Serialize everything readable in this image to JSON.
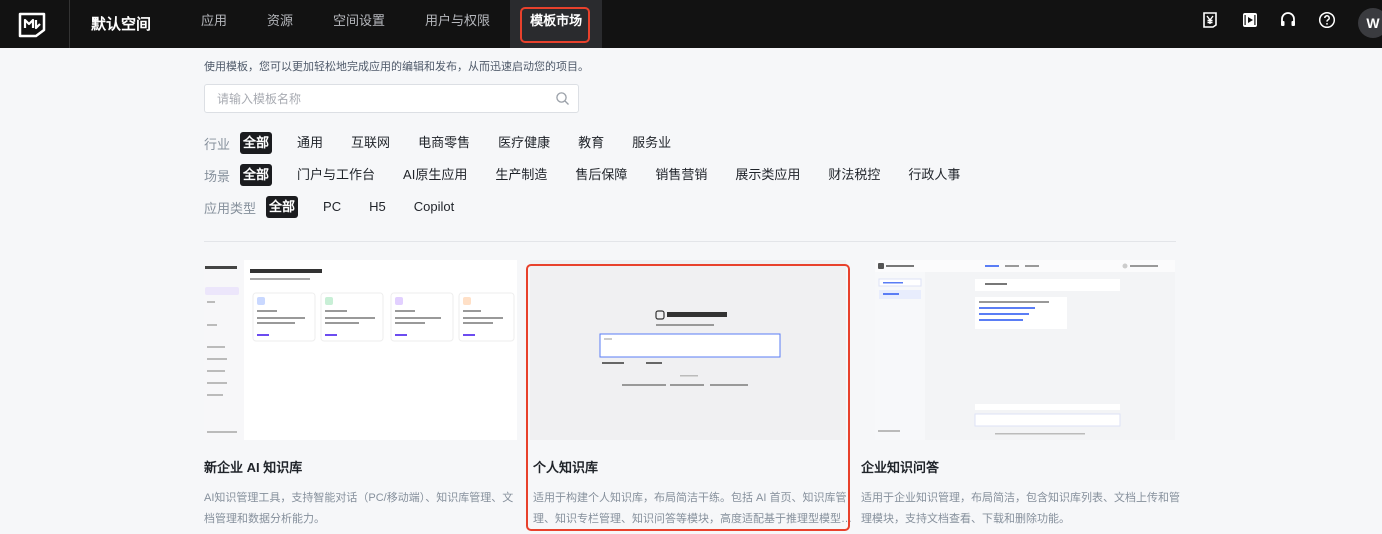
{
  "topbar": {
    "space_name": "默认空间",
    "nav": [
      {
        "label": "应用"
      },
      {
        "label": "资源"
      },
      {
        "label": "空间设置"
      },
      {
        "label": "用户与权限"
      },
      {
        "label": "模板市场",
        "active": true
      }
    ],
    "icons": [
      "yen-icon",
      "video-icon",
      "headset-icon",
      "help-icon"
    ],
    "avatar_letter": "W",
    "highlight_color": "#e8412c"
  },
  "intro_text": "使用模板，您可以更加轻松地完成应用的编辑和发布，从而迅速启动您的项目。",
  "search": {
    "placeholder": "请输入模板名称",
    "value": ""
  },
  "filters": {
    "industry": {
      "label": "行业",
      "options": [
        "全部",
        "通用",
        "互联网",
        "电商零售",
        "医疗健康",
        "教育",
        "服务业"
      ],
      "selected": "全部"
    },
    "scene": {
      "label": "场景",
      "options": [
        "全部",
        "门户与工作台",
        "AI原生应用",
        "生产制造",
        "售后保障",
        "销售营销",
        "展示类应用",
        "财法税控",
        "行政人事"
      ],
      "selected": "全部"
    },
    "app_type": {
      "label": "应用类型",
      "options": [
        "全部",
        "PC",
        "H5",
        "Copilot"
      ],
      "selected": "全部"
    }
  },
  "cards": [
    {
      "title": "新企业 AI 知识库",
      "desc_line1": "AI知识管理工具，支持智能对话（PC/移动端）、知识库管理、文",
      "desc_line2": "档管理和数据分析能力。"
    },
    {
      "title": "个人知识库",
      "desc_line1": "适用于构建个人知识库，布局简洁干练。包括 AI 首页、知识库管",
      "desc_line2": "理、知识专栏管理、知识问答等模块，高度适配基于推理型模型…",
      "highlighted": true
    },
    {
      "title": "企业知识问答",
      "desc_line1": "适用于企业知识管理，布局简洁，包含知识库列表、文档上传和管",
      "desc_line2": "理模块，支持文档查看、下载和删除功能。"
    }
  ]
}
